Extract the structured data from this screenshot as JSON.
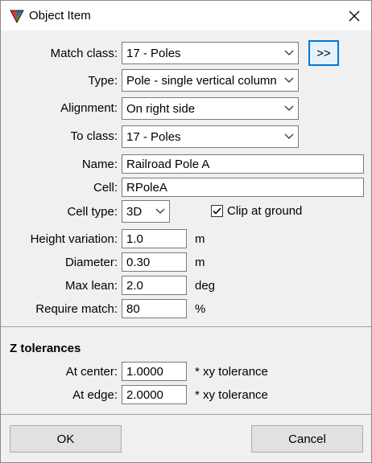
{
  "window": {
    "title": "Object Item",
    "close_icon": "close-icon",
    "app_icon": "app-icon"
  },
  "form": {
    "match_class": {
      "label": "Match class:",
      "value": "17 - Poles",
      "more_button": ">>"
    },
    "type": {
      "label": "Type:",
      "value": "Pole - single vertical column"
    },
    "alignment": {
      "label": "Alignment:",
      "value": "On right side"
    },
    "to_class": {
      "label": "To class:",
      "value": "17 - Poles"
    },
    "name": {
      "label": "Name:",
      "value": "Railroad Pole A"
    },
    "cell": {
      "label": "Cell:",
      "value": "RPoleA"
    },
    "cell_type": {
      "label": "Cell type:",
      "value": "3D"
    },
    "clip_at_ground": {
      "label": "Clip at ground",
      "checked": true
    },
    "height_variation": {
      "label": "Height variation:",
      "value": "1.0",
      "unit": "m"
    },
    "diameter": {
      "label": "Diameter:",
      "value": "0.30",
      "unit": "m"
    },
    "max_lean": {
      "label": "Max lean:",
      "value": "2.0",
      "unit": "deg"
    },
    "require_match": {
      "label": "Require match:",
      "value": "80",
      "unit": "%"
    }
  },
  "z_tolerances": {
    "title": "Z tolerances",
    "at_center": {
      "label": "At center:",
      "value": "1.0000",
      "unit": "* xy tolerance"
    },
    "at_edge": {
      "label": "At edge:",
      "value": "2.0000",
      "unit": "* xy tolerance"
    }
  },
  "buttons": {
    "ok": "OK",
    "cancel": "Cancel"
  }
}
